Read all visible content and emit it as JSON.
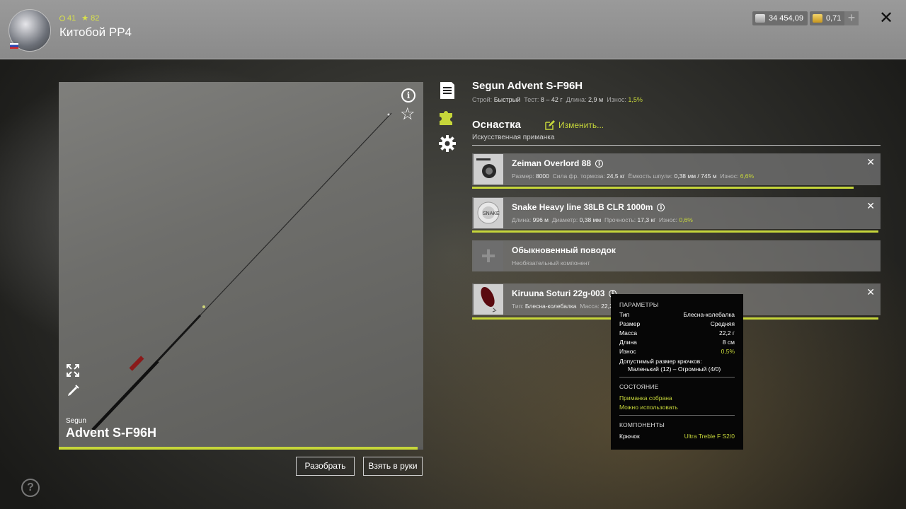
{
  "header": {
    "level": "41",
    "rank": "82",
    "username": "Китобой РР4",
    "silver": "34 454,09",
    "gold": "0,71",
    "plus": "+",
    "close": "✕"
  },
  "preview": {
    "brand": "Segun",
    "model": "Advent S-F96H",
    "wear_fraction": 0.985
  },
  "buttons": {
    "disassemble": "Разобрать",
    "take": "Взять в руки"
  },
  "rod": {
    "title": "Segun Advent S-F96H",
    "build_label": "Строй:",
    "build": "Быстрый",
    "test_label": "Тест:",
    "test": "8 – 42 г",
    "length_label": "Длина:",
    "length": "2,9 м",
    "wear_label": "Износ:",
    "wear": "1,5%"
  },
  "rig": {
    "title": "Оснастка",
    "edit": "Изменить...",
    "type": "Искусственная приманка"
  },
  "components": [
    {
      "name": "Zeiman Overlord 88",
      "meta": [
        {
          "k": "Размер:",
          "v": "8000"
        },
        {
          "k": "Сила фр. тормоза:",
          "v": "24,5 кг"
        },
        {
          "k": "Ёмкость шпули:",
          "v": "0,38 мм / 745 м"
        },
        {
          "k": "Износ:",
          "v": "6,6%"
        }
      ],
      "bar_fraction": 0.934
    },
    {
      "name": "Snake Heavy line 38LB CLR 1000m",
      "meta": [
        {
          "k": "Длина:",
          "v": "996 м"
        },
        {
          "k": "Диаметр:",
          "v": "0,38 мм"
        },
        {
          "k": "Прочность:",
          "v": "17,3 кг"
        },
        {
          "k": "Износ:",
          "v": "0,6%"
        }
      ],
      "bar_fraction": 0.994
    },
    {
      "name": "Обыкновенный поводок",
      "sub": "Необязательный компонент"
    },
    {
      "name": "Kiruuna Soturi 22g-003",
      "meta": [
        {
          "k": "Тип:",
          "v": "Блесна-колебалка"
        },
        {
          "k": "Масса:",
          "v": "22,2"
        }
      ],
      "bar_fraction": 0.995
    }
  ],
  "tooltip": {
    "params_title": "ПАРАМЕТРЫ",
    "rows": [
      {
        "k": "Тип",
        "v": "Блесна-колебалка"
      },
      {
        "k": "Размер",
        "v": "Средняя"
      },
      {
        "k": "Масса",
        "v": "22,2 г"
      },
      {
        "k": "Длина",
        "v": "8 см"
      },
      {
        "k": "Износ",
        "v": "0,5%"
      }
    ],
    "hook_label": "Допустимый размер крючков:",
    "hook_range": "Маленький (12) – Огромный (4/0)",
    "state_title": "СОСТОЯНИЕ",
    "state_1": "Приманка собрана",
    "state_2": "Можно использовать",
    "components_title": "КОМПОНЕНТЫ",
    "comp_k": "Крючок",
    "comp_v": "Ultra Treble F S2/0"
  },
  "colors": {
    "accent": "#c6d63a"
  }
}
